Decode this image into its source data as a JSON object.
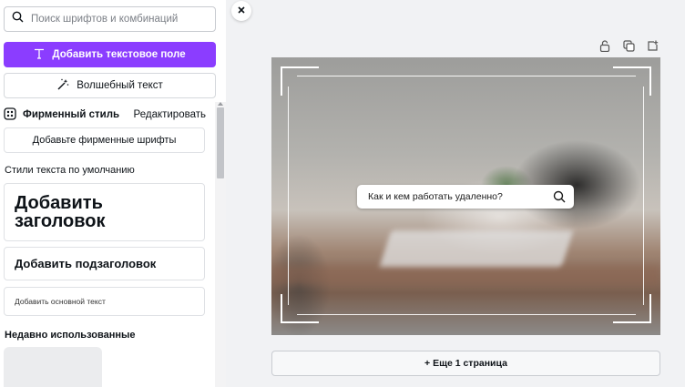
{
  "sidebar": {
    "search_placeholder": "Поиск шрифтов и комбинаций",
    "add_text_box": "Добавить текстовое поле",
    "magic_text": "Волшебный текст",
    "brand_style": {
      "title": "Фирменный стиль",
      "edit": "Редактировать"
    },
    "add_brand_fonts": "Добавьте фирменные шрифты",
    "default_styles_label": "Стили текста по умолчанию",
    "heading": "Добавить заголовок",
    "subheading": "Добавить подзаголовок",
    "body_text": "Добавить основной текст",
    "recently_used_label": "Недавно использованные"
  },
  "canvas": {
    "search_text": "Как и кем работать удаленно?"
  },
  "add_page": "+ Еще 1 страница",
  "colors": {
    "accent": "#8b3dff"
  },
  "icons": [
    "search-icon",
    "text-icon",
    "magic-wand-icon",
    "palette-icon",
    "close-icon",
    "lock-icon",
    "duplicate-icon",
    "add-page-icon"
  ]
}
